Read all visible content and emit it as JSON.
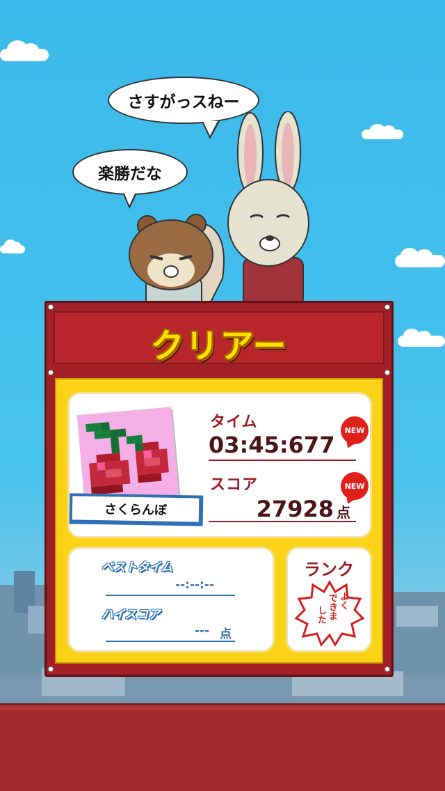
{
  "speech": {
    "rabbit_line": "さすがっスねー",
    "squirrel_line": "楽勝だな"
  },
  "board": {
    "title": "クリアー",
    "puzzle_name": "さくらんぼ",
    "time": {
      "label": "タイム",
      "value": "03:45:677",
      "new_badge": "NEW"
    },
    "score": {
      "label": "スコア",
      "value": "27928",
      "unit": "点",
      "new_badge": "NEW"
    },
    "best_time": {
      "label": "ベストタイム",
      "value": "--:--:--"
    },
    "high_score": {
      "label": "ハイスコア",
      "value": "---",
      "unit": "点"
    },
    "rank": {
      "label": "ランク",
      "stamp_col1": "よく",
      "stamp_col2": "できま",
      "stamp_col3": "した"
    }
  },
  "colors": {
    "sky": "#3bb9ea",
    "board_red": "#a21f25",
    "board_yellow": "#fbd216",
    "title_yellow": "#ffe000",
    "accent_blue": "#2c73b6",
    "stamp_red": "#d4201f"
  },
  "icons": {
    "thumbnail": "cherry-pixel-art-icon",
    "rank_stamp": "sakura-stamp-icon"
  }
}
